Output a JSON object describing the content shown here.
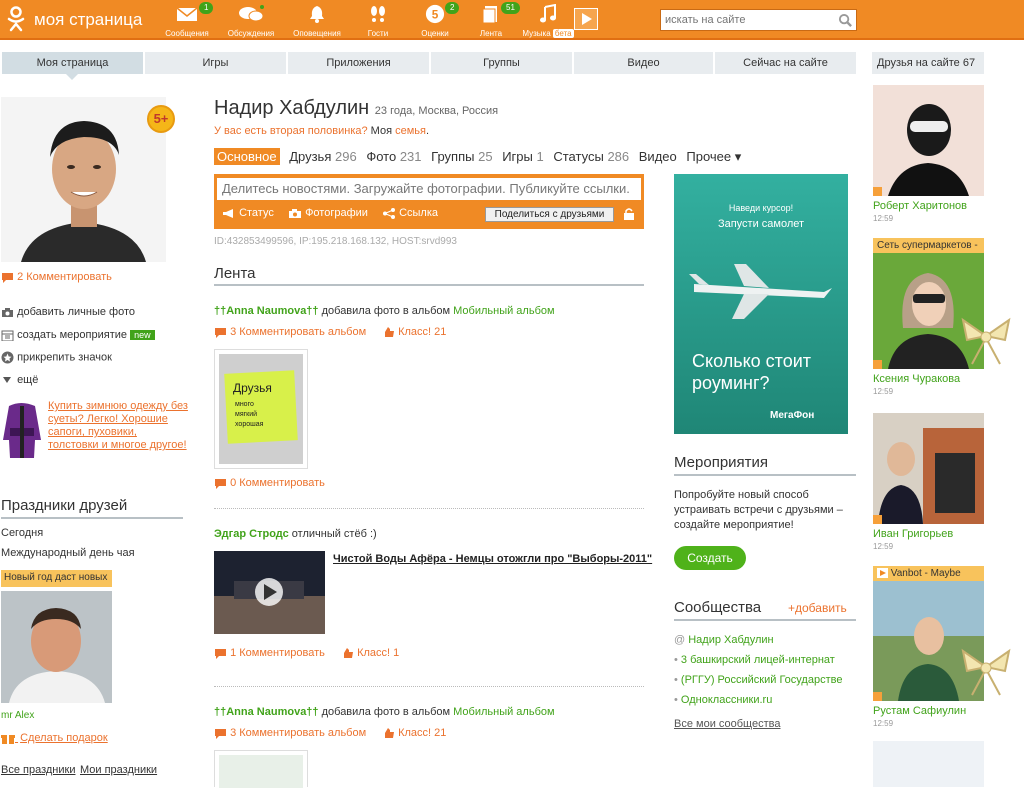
{
  "header": {
    "logo_text": "моя страница",
    "search_placeholder": "искать на сайте",
    "nav": [
      {
        "label": "Сообщения",
        "icon": "envelope-icon",
        "count": "1"
      },
      {
        "label": "Обсуждения",
        "icon": "discussions-icon",
        "count": ""
      },
      {
        "label": "Оповещения",
        "icon": "bell-icon",
        "count": ""
      },
      {
        "label": "Гости",
        "icon": "footprints-icon",
        "count": ""
      },
      {
        "label": "Оценки",
        "icon": "rating-icon",
        "count": "2",
        "badge": "5"
      },
      {
        "label": "Лента",
        "icon": "feed-icon",
        "count": "51"
      },
      {
        "label": "Музыка",
        "icon": "music-icon",
        "count": "",
        "beta": "бета"
      }
    ]
  },
  "tabs": [
    "Моя страница",
    "Игры",
    "Приложения",
    "Группы",
    "Видео",
    "Сейчас на сайте"
  ],
  "profile": {
    "name": "Надир Хабдулин",
    "meta": "23 года, Москва, Россия",
    "partner_link": "У вас есть вторая половинка?",
    "family_prefix": "Моя",
    "family_link": "семья",
    "badge": "5+",
    "comments": "2 Комментировать",
    "actions": [
      {
        "label": "добавить личные фото",
        "icon": "camera-icon"
      },
      {
        "label": "создать мероприятие",
        "icon": "calendar-icon",
        "tag": "new"
      },
      {
        "label": "прикрепить значок",
        "icon": "star-badge-icon"
      },
      {
        "label": "ещё",
        "icon": "triangle-down-icon"
      }
    ],
    "ad_text": "Купить зимнюю одежду без суеты? Легко! Хорошие сапоги, пуховики, толстовки и многое другое!",
    "tech": "ID:432853499596, IP:195.218.168.132, HOST:srvd993"
  },
  "subtabs": [
    {
      "label": "Основное",
      "count": ""
    },
    {
      "label": "Друзья",
      "count": "296"
    },
    {
      "label": "Фото",
      "count": "231"
    },
    {
      "label": "Группы",
      "count": "25"
    },
    {
      "label": "Игры",
      "count": "1"
    },
    {
      "label": "Статусы",
      "count": "286"
    },
    {
      "label": "Видео",
      "count": ""
    },
    {
      "label": "Прочее ▾",
      "count": ""
    }
  ],
  "share": {
    "placeholder": "Делитесь новостями. Загружайте фотографии. Публикуйте ссылки.",
    "status": "Статус",
    "photos": "Фотографии",
    "links": "Ссылка",
    "button": "Поделиться с друзьями"
  },
  "feed": {
    "title": "Лента",
    "items": [
      {
        "author": "††Anna Naumova††",
        "text": "добавила фото в альбом",
        "album": "Мобильный альбом",
        "comments": "3 Комментировать альбом",
        "klass": "Класс! 21",
        "photo_comments": "0 Комментировать"
      },
      {
        "author": "Эдгар Стродс",
        "text": "отличный стёб :)",
        "video_title": "Чистой Воды Афёра - Немцы отожгли про \"Выборы-2011\"",
        "comments": "1 Комментировать",
        "klass": "Класс! 1"
      },
      {
        "author": "††Anna Naumova††",
        "text": "добавила фото в альбом",
        "album": "Мобильный альбом",
        "comments": "3 Комментировать альбом",
        "klass": "Класс! 21"
      }
    ],
    "note_text": "Друзья много мягкий хорошая"
  },
  "banner": {
    "top1": "Наведи курсор!",
    "top2": "Запусти самолет",
    "main": "Сколько стоит роуминг?",
    "brand": "МегаФон"
  },
  "events": {
    "title": "Мероприятия",
    "text": "Попробуйте новый способ устраивать встречи с друзьями – создайте мероприятие!",
    "button": "Создать"
  },
  "communities": {
    "title": "Сообщества",
    "add": "+добавить",
    "items": [
      "Надир Хабдулин",
      "3 башкирский лицей-интернат",
      "(РГГУ) Российский Государстве",
      "Одноклассники.ru"
    ],
    "all": "Все мои сообщества"
  },
  "holidays": {
    "title": "Праздники друзей",
    "today": "Сегодня",
    "holiday": "Международный день чая",
    "badge": "Новый год даст новых",
    "friend": "mr Alex",
    "gift": "Сделать подарок",
    "all": "Все праздники",
    "mine": "Мои праздники"
  },
  "friends_online": {
    "title": "Друзья на сайте 67",
    "items": [
      {
        "name": "Роберт Харитонов",
        "time": "12:59",
        "badge": ""
      },
      {
        "name": "Ксения Чуракова",
        "time": "12:59",
        "badge": "Сеть супермаркетов -"
      },
      {
        "name": "Иван Григорьев",
        "time": "12:59",
        "badge": ""
      },
      {
        "name": "Рустам Сафиулин",
        "time": "12:59",
        "badge": "Vanbot - Maybe"
      }
    ]
  },
  "colors": {
    "brand_orange": "#f08a24",
    "green": "#41a31a",
    "link": "#eb722e"
  }
}
